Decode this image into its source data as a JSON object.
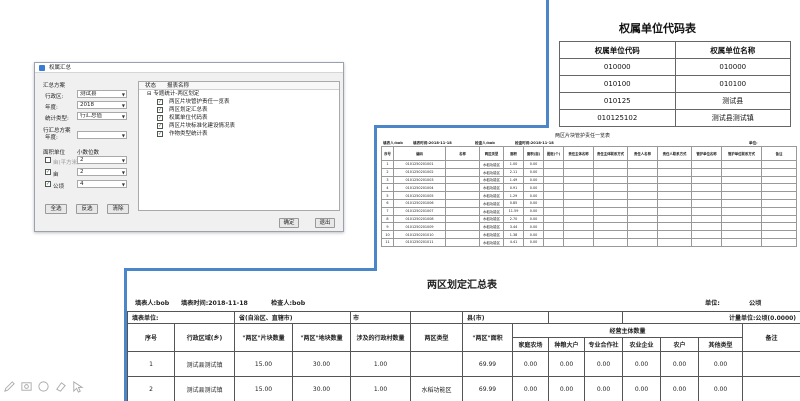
{
  "dialog": {
    "title": "权属汇总",
    "scheme_label": "汇总方案",
    "fields": [
      {
        "label": "行政区:",
        "value": "测试县"
      },
      {
        "label": "年度:",
        "value": "2018"
      },
      {
        "label": "统计类型:",
        "value": "行汇总值"
      }
    ],
    "row_scheme_label": "行汇总方案",
    "row_year_label": "年度:",
    "unit_section_label": "面积单位",
    "decimal_label": "小数位数",
    "units": [
      {
        "label": "亩(平方米)",
        "checked": false,
        "value": "2"
      },
      {
        "label": "亩",
        "checked": true,
        "value": "2"
      },
      {
        "label": "公顷",
        "checked": true,
        "value": "4"
      }
    ],
    "buttons": {
      "select_all": "全选",
      "invert": "反选",
      "clear": "清除",
      "ok": "确定",
      "cancel": "退出"
    },
    "list_headers": {
      "state": "状态",
      "name": "报表名称"
    },
    "list_items": [
      {
        "label": "专题统计-两区划定",
        "level": 0,
        "checked": false
      },
      {
        "label": "两区片块管护责任一览表",
        "level": 1,
        "checked": true
      },
      {
        "label": "两区划定汇总表",
        "level": 1,
        "checked": true
      },
      {
        "label": "权属单位代码表",
        "level": 1,
        "checked": true
      },
      {
        "label": "两区片块标准化建设情况表",
        "level": 1,
        "checked": true
      },
      {
        "label": "作物类型统计表",
        "level": 1,
        "checked": true
      }
    ]
  },
  "code_table": {
    "title": "权属单位代码表",
    "headers": [
      "权属单位代码",
      "权属单位名称"
    ],
    "rows": [
      [
        "010000",
        "010000"
      ],
      [
        "010100",
        "010100"
      ],
      [
        "010125",
        "测试县"
      ],
      [
        "010125102",
        "测试县测试镇"
      ]
    ]
  },
  "parcel_table": {
    "title": "两区片块管护责任一览表",
    "meta": [
      {
        "text": "填表人:bob"
      },
      {
        "text": "填表时间:2018-11-18"
      },
      {
        "text": "检查人:bob"
      },
      {
        "text": "检查时间:2018-11-18"
      },
      {
        "text": "单位:"
      }
    ],
    "headers": [
      "序号",
      "编码",
      "名称",
      "两区类型",
      "面积",
      "面积(亩)",
      "图斑(个)",
      "责任主体名称",
      "责任主体联系方式",
      "责任人名称",
      "责任人联系方式",
      "管护单位名称",
      "管护单位联系方式",
      "备注"
    ],
    "rows": [
      [
        "1",
        "0101250201001",
        "",
        "水稻功能区",
        "1.00",
        "0.00"
      ],
      [
        "2",
        "0101250201002",
        "",
        "水稻功能区",
        "2.11",
        "0.00"
      ],
      [
        "3",
        "0101250201003",
        "",
        "水稻功能区",
        "1.49",
        "0.00"
      ],
      [
        "4",
        "0101250201004",
        "",
        "水稻功能区",
        "0.91",
        "0.00"
      ],
      [
        "5",
        "0101250201005",
        "",
        "水稻功能区",
        "1.29",
        "0.00"
      ],
      [
        "6",
        "0101250201006",
        "",
        "水稻功能区",
        "0.85",
        "0.00"
      ],
      [
        "7",
        "0101250201007",
        "",
        "水稻功能区",
        "11.59",
        "0.00"
      ],
      [
        "8",
        "0101250201008",
        "",
        "水稻功能区",
        "2.70",
        "0.00"
      ],
      [
        "9",
        "0101250201009",
        "",
        "水稻功能区",
        "3.44",
        "0.00"
      ],
      [
        "10",
        "0101250201010",
        "",
        "水稻功能区",
        "1.38",
        "0.00"
      ],
      [
        "11",
        "0101250201011",
        "",
        "水稻功能区",
        "4.41",
        "0.00"
      ]
    ]
  },
  "summary_table": {
    "title": "两区划定汇总表",
    "meta": {
      "filler": "填表人:bob",
      "fill_time": "填表时间:2018-11-18",
      "checker": "检查人:bob",
      "unit": "单位:",
      "unit_value": "公顷",
      "fill_unit": "填表单位:",
      "province": "省(自治区、直辖市)",
      "city": "市",
      "county": "县(市)",
      "measure_unit": "计量单位:公顷(0.0000)"
    },
    "headers": {
      "seq": "序号",
      "region": "行政区域(乡)",
      "count": "\"两区\"片块数量",
      "parcels": "\"两区\"地块数量",
      "villages": "涉及的行政村数量",
      "type": "两区类型",
      "area": "\"两区\"面积",
      "subject_group": "经营主体数量",
      "subjects": [
        "家庭农场",
        "种粮大户",
        "专业合作社",
        "农业企业",
        "农户",
        "其他类型"
      ],
      "note": "备注"
    },
    "rows": [
      {
        "seq": "1",
        "region": "测试县测试镇",
        "count": "15.00",
        "parcels": "30.00",
        "villages": "1.00",
        "type": "",
        "area": "69.99",
        "subjects": [
          "0.00",
          "0.00",
          "0.00",
          "0.00",
          "0.00",
          "0.00"
        ],
        "note": ""
      },
      {
        "seq": "2",
        "region": "测试县测试镇",
        "count": "15.00",
        "parcels": "30.00",
        "villages": "1.00",
        "type": "水稻功能区",
        "area": "69.99",
        "subjects": [
          "0.00",
          "0.00",
          "0.00",
          "0.00",
          "0.00",
          "0.00"
        ],
        "note": ""
      }
    ]
  },
  "toolbar_icons": [
    "pen-icon",
    "screen-capture-icon",
    "shape-icon",
    "eraser-icon",
    "pointer-icon"
  ],
  "colors": {
    "accent_bar": "#4a86c8",
    "check": "#1a8a1a"
  }
}
